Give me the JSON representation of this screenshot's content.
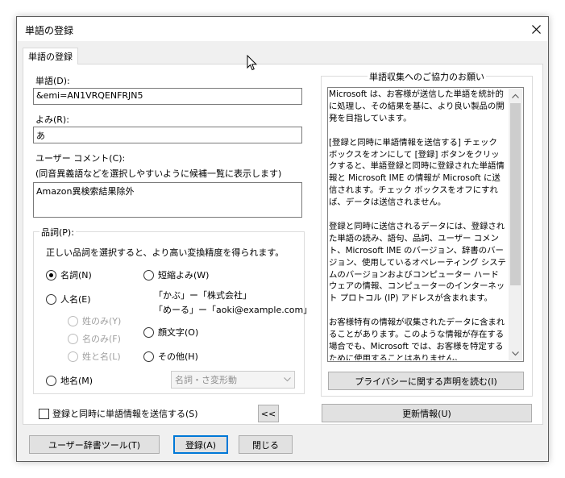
{
  "window": {
    "title": "単語の登録"
  },
  "tab": {
    "label": "単語の登録"
  },
  "fields": {
    "word_label": "単語(D):",
    "word_value": "&emi=AN1VRQENFRJN5",
    "reading_label": "よみ(R):",
    "reading_value": "あ",
    "comment_label": "ユーザー コメント(C):",
    "comment_hint": "(同音異義語などを選択しやすいように候補一覧に表示します)",
    "comment_value": "Amazon異検索結果除外"
  },
  "pos": {
    "group_label": "品詞(P):",
    "description": "正しい品詞を選択すると、より高い変換精度を得られます。",
    "noun": "名詞(N)",
    "person_name": "人名(E)",
    "surname_only": "姓のみ(Y)",
    "given_only": "名のみ(F)",
    "surname_given": "姓と名(L)",
    "place_name": "地名(M)",
    "short_reading": "短縮よみ(W)",
    "example1": "「かぶ」ー「株式会社」",
    "example2": "「めーる」ー「aoki@example.com」",
    "emoticon": "顔文字(O)",
    "other": "その他(H)",
    "dropdown_value": "名詞・さ変形動"
  },
  "send_checkbox": "登録と同時に単語情報を送信する(S)",
  "collapse_button": "<<",
  "info": {
    "title": "単語収集へのご協力のお願い",
    "paragraphs": [
      "Microsoft は、お客様が送信した単語を統計的に処理し、その結果を基に、より良い製品の開発を目指しています。",
      "[登録と同時に単語情報を送信する] チェック ボックスをオンにして [登録] ボタンをクリックすると、単語登録と同時に登録された単語情報と Microsoft IME の情報が Microsoft に送信されます。チェック ボックスをオフにすれば、データは送信されません。",
      "登録と同時に送信されるデータには、登録された単語の読み、語句、品詞、ユーザー コメント、Microsoft IME のバージョン、辞書のバージョン、使用しているオペレーティング システムのバージョンおよびコンピューター ハードウェアの情報、コンピューターのインターネット プロトコル (IP) アドレスが含まれます。",
      "お客様特有の情報が収集されたデータに含まれることがあります。このような情報が存在する場合でも、Microsoft では、お客様を特定するために使用することはありません。"
    ],
    "privacy_button": "プライバシーに関する声明を読む(I)"
  },
  "update_button": "更新情報(U)",
  "footer": {
    "dictionary_tool": "ユーザー辞書ツール(T)",
    "register": "登録(A)",
    "close": "閉じる"
  }
}
